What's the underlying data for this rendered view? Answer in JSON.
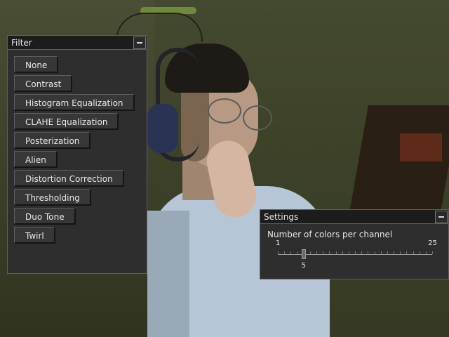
{
  "filter_window": {
    "title": "Filter",
    "buttons": [
      {
        "label": "None"
      },
      {
        "label": "Contrast"
      },
      {
        "label": "Histogram Equalization"
      },
      {
        "label": "CLAHE Equalization"
      },
      {
        "label": "Posterization"
      },
      {
        "label": "Alien"
      },
      {
        "label": "Distortion Correction"
      },
      {
        "label": "Thresholding"
      },
      {
        "label": "Duo Tone"
      },
      {
        "label": "Twirl"
      }
    ]
  },
  "settings_window": {
    "title": "Settings",
    "slider": {
      "label": "Number of colors per channel",
      "min": 1,
      "max": 25,
      "value": 5
    }
  }
}
